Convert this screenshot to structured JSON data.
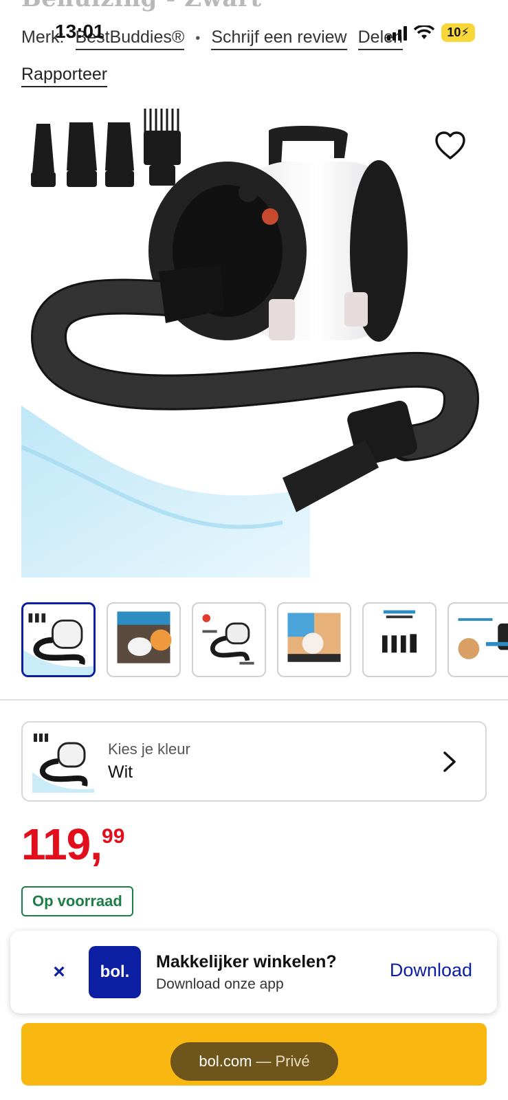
{
  "product": {
    "title_fragment": "Behuizing - Zwart",
    "brand_prefix": "Merk:",
    "brand": "BestBuddies®",
    "review_link": "Schrijf een review",
    "share_link": "Delen",
    "report_link": "Rapporteer"
  },
  "status_bar": {
    "time": "13:01",
    "battery": "10"
  },
  "color_selector": {
    "label": "Kies je kleur",
    "value": "Wit"
  },
  "price": {
    "whole": "119,",
    "cents": "99"
  },
  "stock": "Op voorraad",
  "app_banner": {
    "close": "×",
    "logo": "bol.",
    "title": "Makkelijker winkelen?",
    "subtitle": "Download onze app",
    "action": "Download"
  },
  "browser": {
    "domain": "bol.com",
    "separator": "—",
    "mode": "Privé"
  },
  "colors": {
    "brand_blue": "#0c1ea1",
    "price_red": "#e10e1b",
    "stock_green": "#1c7d45",
    "cta_yellow": "#f9b711"
  }
}
